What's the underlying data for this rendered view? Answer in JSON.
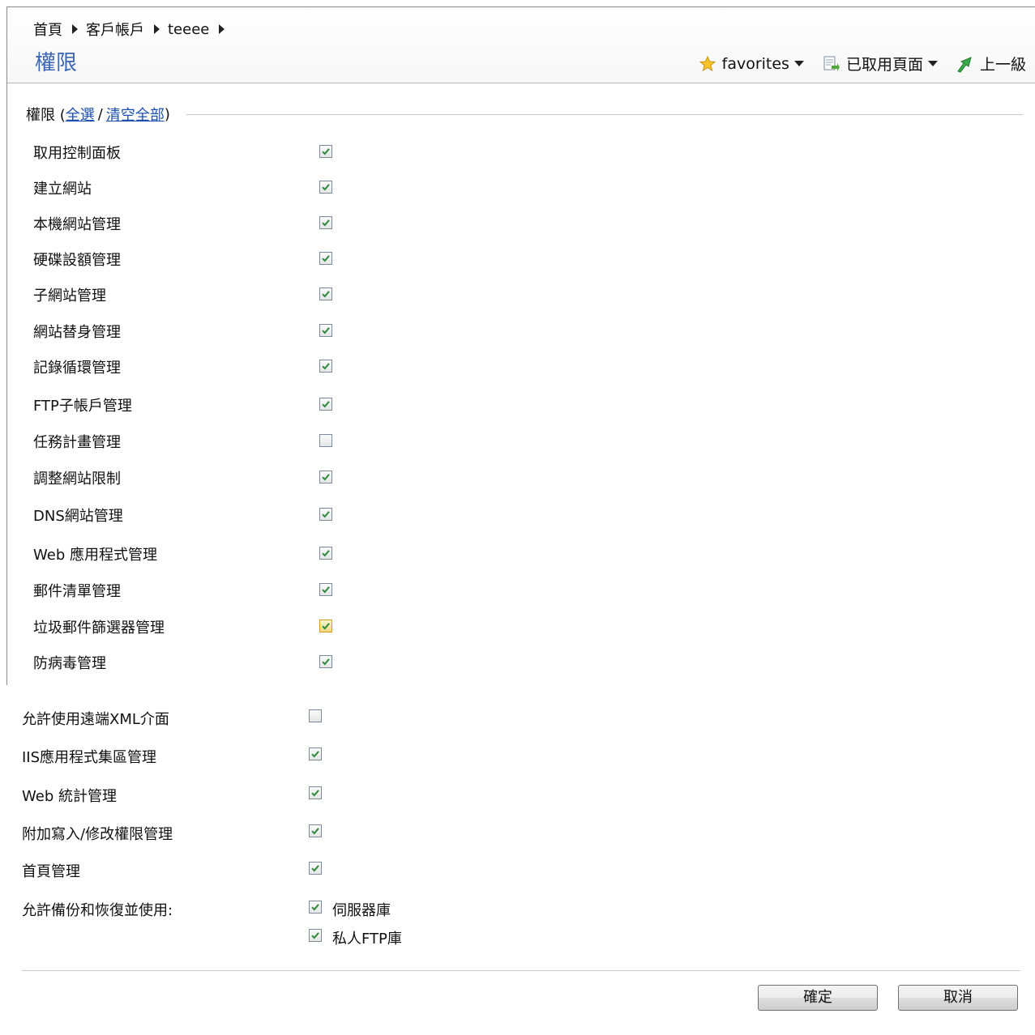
{
  "breadcrumb": [
    "首頁",
    "客戶帳戶",
    "teeee"
  ],
  "title": "權限",
  "toolbar": {
    "favorites": "favorites",
    "pages": "已取用頁面",
    "up": "上一級"
  },
  "section": {
    "label": "權限 (",
    "select_all": "全選",
    "separator": "/",
    "clear_all": "清空全部",
    "close": ")"
  },
  "permissions": [
    {
      "label": "取用控制面板",
      "checked": true
    },
    {
      "label": "建立網站",
      "checked": true
    },
    {
      "label": "本機網站管理",
      "checked": true
    },
    {
      "label": "硬碟設額管理",
      "checked": true
    },
    {
      "label": "子網站管理",
      "checked": true
    },
    {
      "label": "網站替身管理",
      "checked": true
    },
    {
      "label": "記錄循環管理",
      "checked": true
    },
    {
      "label": "FTP子帳戶管理",
      "checked": true
    },
    {
      "label": "任務計畫管理",
      "checked": false
    },
    {
      "label": "調整網站限制",
      "checked": true
    },
    {
      "label": "DNS網站管理",
      "checked": true
    },
    {
      "label": "Web 應用程式管理",
      "checked": true
    },
    {
      "label": "郵件清單管理",
      "checked": true
    },
    {
      "label": "垃圾郵件篩選器管理",
      "checked": true,
      "hover": true
    },
    {
      "label": "防病毒管理",
      "checked": true
    }
  ],
  "permissions_lower": [
    {
      "label": "允許使用遠端XML介面",
      "checked": false
    },
    {
      "label": "IIS應用程式集區管理",
      "checked": true
    },
    {
      "label": "Web 統計管理",
      "checked": true
    },
    {
      "label": "附加寫入/修改權限管理",
      "checked": true
    },
    {
      "label": "首頁管理",
      "checked": true
    }
  ],
  "backup": {
    "label": "允許備份和恢復並使用:",
    "options": [
      {
        "label": "伺服器庫",
        "checked": true
      },
      {
        "label": "私人FTP庫",
        "checked": true
      }
    ]
  },
  "buttons": {
    "ok": "確定",
    "cancel": "取消"
  }
}
